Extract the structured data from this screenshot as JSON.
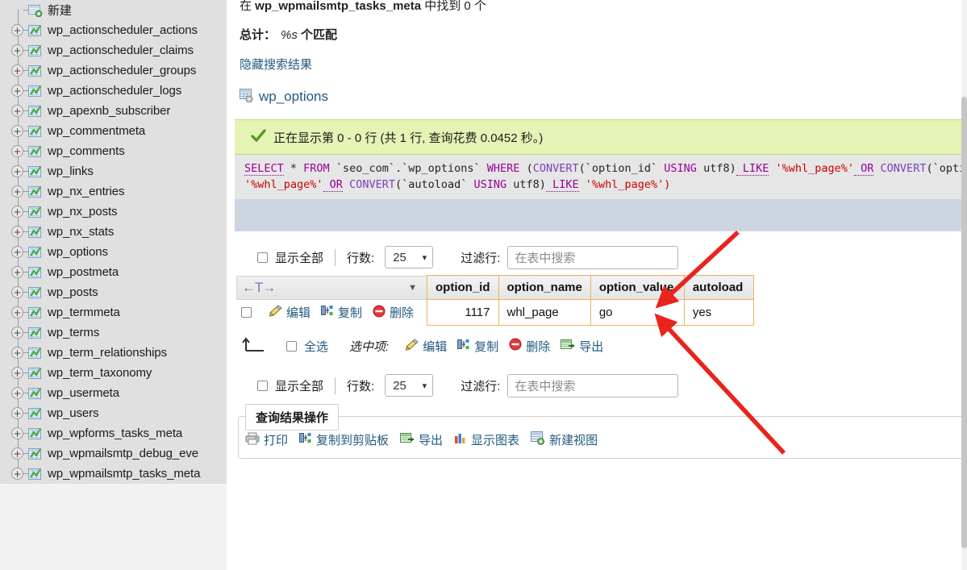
{
  "sidebar": {
    "new_item": {
      "label": "新建",
      "icon": "new-table-icon"
    },
    "tables": [
      {
        "label": "wp_actionscheduler_actions",
        "icon": "table-icon",
        "expander": "+"
      },
      {
        "label": "wp_actionscheduler_claims",
        "icon": "table-icon",
        "expander": "+"
      },
      {
        "label": "wp_actionscheduler_groups",
        "icon": "table-icon",
        "expander": "+"
      },
      {
        "label": "wp_actionscheduler_logs",
        "icon": "table-icon",
        "expander": "+"
      },
      {
        "label": "wp_apexnb_subscriber",
        "icon": "table-icon",
        "expander": "+"
      },
      {
        "label": "wp_commentmeta",
        "icon": "table-icon",
        "expander": "+"
      },
      {
        "label": "wp_comments",
        "icon": "table-icon",
        "expander": "+"
      },
      {
        "label": "wp_links",
        "icon": "table-icon",
        "expander": "+"
      },
      {
        "label": "wp_nx_entries",
        "icon": "table-icon",
        "expander": "+"
      },
      {
        "label": "wp_nx_posts",
        "icon": "table-icon",
        "expander": "+"
      },
      {
        "label": "wp_nx_stats",
        "icon": "table-icon",
        "expander": "+"
      },
      {
        "label": "wp_options",
        "icon": "table-icon",
        "expander": "+"
      },
      {
        "label": "wp_postmeta",
        "icon": "table-icon",
        "expander": "+"
      },
      {
        "label": "wp_posts",
        "icon": "table-icon",
        "expander": "+"
      },
      {
        "label": "wp_termmeta",
        "icon": "table-icon",
        "expander": "+"
      },
      {
        "label": "wp_terms",
        "icon": "table-icon",
        "expander": "+"
      },
      {
        "label": "wp_term_relationships",
        "icon": "table-icon",
        "expander": "+"
      },
      {
        "label": "wp_term_taxonomy",
        "icon": "table-icon",
        "expander": "+"
      },
      {
        "label": "wp_usermeta",
        "icon": "table-icon",
        "expander": "+"
      },
      {
        "label": "wp_users",
        "icon": "table-icon",
        "expander": "+"
      },
      {
        "label": "wp_wpforms_tasks_meta",
        "icon": "table-icon",
        "expander": "+"
      },
      {
        "label": "wp_wpmailsmtp_debug_eve",
        "icon": "table-icon",
        "expander": "+"
      },
      {
        "label": "wp_wpmailsmtp_tasks_meta",
        "icon": "table-icon",
        "expander": "+"
      }
    ]
  },
  "main": {
    "found_prefix": "在 ",
    "found_table": "wp_wpmailsmtp_tasks_meta",
    "found_suffix": " 中找到 0 个",
    "total_label": "总计：",
    "total_value": "%s",
    "total_suffix": " 个匹配",
    "hide_results_link": "隐藏搜索结果",
    "result_table_name": "wp_options",
    "success_message": "正在显示第 0 - 0 行 (共 1 行, 查询花费 0.0452 秒。)",
    "sql": {
      "full": "SELECT * FROM `seo_com`.`wp_options` WHERE (CONVERT(`option_id` USING utf8) LIKE '%whl_page%' OR CONVERT(`option_name` USING utf8) LIKE '%whl_page%' OR CONVERT(`option_value` USING utf8) LIKE '%whl_page%' OR CONVERT(`autoload` USING utf8) LIKE '%whl_page%')",
      "line1": [
        {
          "t": "SELECT",
          "c": "kwu"
        },
        {
          "t": " * ",
          "c": "punc"
        },
        {
          "t": "FROM",
          "c": "kw"
        },
        {
          "t": " `seo_com`",
          "c": "ident"
        },
        {
          "t": ".",
          "c": "punc"
        },
        {
          "t": "`wp_options`",
          "c": "ident"
        },
        {
          "t": " ",
          "c": "punc"
        },
        {
          "t": "WHERE",
          "c": "kw"
        },
        {
          "t": " (",
          "c": "punc"
        },
        {
          "t": "CONVERT",
          "c": "func"
        },
        {
          "t": "(`option_id`",
          "c": "ident"
        },
        {
          "t": " USING",
          "c": "kw"
        },
        {
          "t": " utf8)",
          "c": "ident"
        },
        {
          "t": " LIKE",
          "c": "kwu"
        },
        {
          "t": " '%whl_page%'",
          "c": "str"
        },
        {
          "t": " OR",
          "c": "kwu"
        },
        {
          "t": " CONVERT",
          "c": "func"
        },
        {
          "t": "(`option",
          "c": "ident"
        }
      ],
      "line2": [
        {
          "t": "'%whl_page%'",
          "c": "str"
        },
        {
          "t": " OR",
          "c": "kwu"
        },
        {
          "t": " CONVERT",
          "c": "func"
        },
        {
          "t": "(`autoload`",
          "c": "ident"
        },
        {
          "t": " USING",
          "c": "kw"
        },
        {
          "t": " utf8)",
          "c": "ident"
        },
        {
          "t": " LIKE",
          "c": "kwu"
        },
        {
          "t": " '%whl_page%')",
          "c": "str"
        }
      ]
    },
    "controls_top": {
      "show_all_label": "显示全部",
      "rows_label": "行数:",
      "rows_value": "25",
      "filter_label": "过滤行:",
      "filter_placeholder": "在表中搜索",
      "filter_value": ""
    },
    "controls_bottom": {
      "show_all_label": "显示全部",
      "rows_label": "行数:",
      "rows_value": "25",
      "filter_label": "过滤行:",
      "filter_placeholder": "在表中搜索",
      "filter_value": ""
    },
    "results": {
      "sort_hint": "←T→",
      "columns": [
        "option_id",
        "option_name",
        "option_value",
        "autoload"
      ],
      "rows": [
        {
          "actions": [
            "编辑",
            "复制",
            "删除"
          ],
          "option_id": "1117",
          "option_name": "whl_page",
          "option_value": "go",
          "autoload": "yes"
        }
      ]
    },
    "bulk": {
      "select_all_label": "全选",
      "with_selected_label": "选中项:",
      "actions": [
        "编辑",
        "复制",
        "删除",
        "导出"
      ]
    },
    "query_ops": {
      "legend": "查询结果操作",
      "actions": [
        "打印",
        "复制到剪贴板",
        "导出",
        "显示图表",
        "新建视图"
      ]
    }
  },
  "annotations": {
    "arrow_color": "#e8241c",
    "arrows": [
      {
        "name": "arrow-to-option-value-header",
        "from": [
          915,
          288
        ],
        "to": [
          824,
          372
        ]
      },
      {
        "name": "arrow-to-option-value-cell",
        "from": [
          972,
          562
        ],
        "to": [
          822,
          400
        ]
      }
    ]
  },
  "colors": {
    "sidebar_bg": "#e0e0e0",
    "sidebar_outer_bg": "#f2f2f2",
    "success_bg": "#e5f3b5",
    "sql_bg": "#e6e6e6",
    "sql_toolbar_bg": "#ccd6e0",
    "table_border": "#f0b060",
    "link": "#235a81"
  }
}
